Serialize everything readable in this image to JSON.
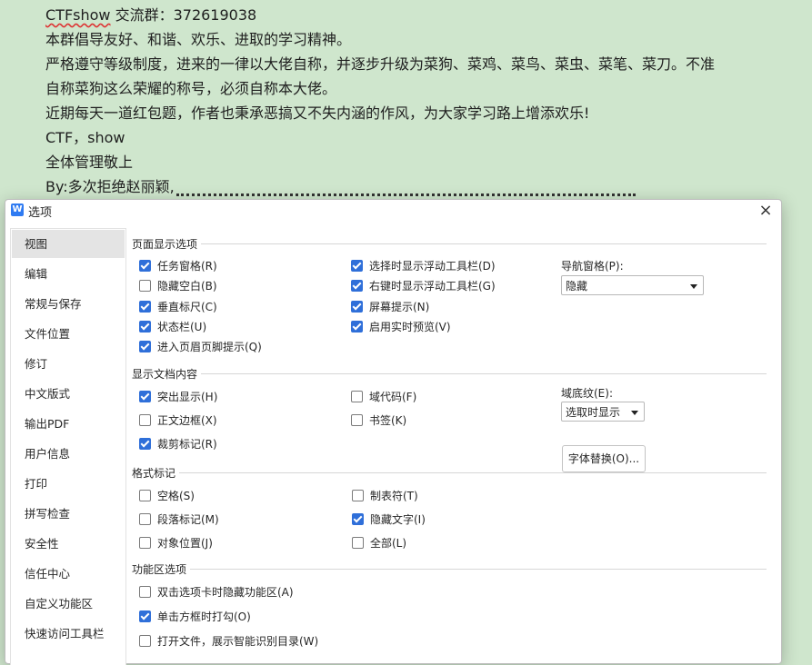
{
  "document": {
    "lines": [
      {
        "prefix": "CTFshow",
        "rest": " 交流群：372619038"
      },
      {
        "text": "本群倡导友好、和谐、欢乐、进取的学习精神。"
      },
      {
        "text": "严格遵守等级制度，进来的一律以大佬自称，并逐步升级为菜狗、菜鸡、菜鸟、菜虫、菜笔、菜刀。不准"
      },
      {
        "text": "自称菜狗这么荣耀的称号，必须自称本大佬。"
      },
      {
        "text": "近期每天一道红包题，作者也秉承恶搞又不失内涵的作风，为大家学习路上增添欢乐!"
      },
      {
        "text": "CTF，show"
      },
      {
        "text": "全体管理敬上"
      },
      {
        "text": "By:多次拒绝赵丽颖,"
      }
    ]
  },
  "dialog": {
    "title": "选项",
    "app_icon": "W",
    "close_glyph": "×",
    "sidebar": [
      {
        "label": "视图",
        "active": true
      },
      {
        "label": "编辑"
      },
      {
        "label": "常规与保存"
      },
      {
        "label": "文件位置"
      },
      {
        "label": "修订"
      },
      {
        "label": "中文版式"
      },
      {
        "label": "输出PDF"
      },
      {
        "label": "用户信息"
      },
      {
        "label": "打印"
      },
      {
        "label": "拼写检查"
      },
      {
        "label": "安全性"
      },
      {
        "label": "信任中心"
      },
      {
        "label": "自定义功能区"
      },
      {
        "label": "快速访问工具栏"
      }
    ],
    "page_display": {
      "title": "页面显示选项",
      "options": [
        {
          "label": "任务窗格(R)",
          "checked": true
        },
        {
          "label": "隐藏空白(B)",
          "checked": false
        },
        {
          "label": "垂直标尺(C)",
          "checked": true
        },
        {
          "label": "状态栏(U)",
          "checked": true
        },
        {
          "label": "进入页眉页脚提示(Q)",
          "checked": true
        },
        {
          "label": "选择时显示浮动工具栏(D)",
          "checked": true
        },
        {
          "label": "右键时显示浮动工具栏(G)",
          "checked": true
        },
        {
          "label": "屏幕提示(N)",
          "checked": true
        },
        {
          "label": "启用实时预览(V)",
          "checked": true
        }
      ],
      "nav_label": "导航窗格(P):",
      "nav_value": "隐藏"
    },
    "doc_content": {
      "title": "显示文档内容",
      "options": [
        {
          "label": "突出显示(H)",
          "checked": true
        },
        {
          "label": "正文边框(X)",
          "checked": false
        },
        {
          "label": "裁剪标记(R)",
          "checked": true
        },
        {
          "label": "域代码(F)",
          "checked": false
        },
        {
          "label": "书签(K)",
          "checked": false
        }
      ],
      "shading_label": "域底纹(E):",
      "shading_value": "选取时显示",
      "font_button": "字体替换(O)..."
    },
    "format_marks": {
      "title": "格式标记",
      "options": [
        {
          "label": "空格(S)",
          "checked": false
        },
        {
          "label": "段落标记(M)",
          "checked": false
        },
        {
          "label": "对象位置(J)",
          "checked": false
        },
        {
          "label": "制表符(T)",
          "checked": false
        },
        {
          "label": "隐藏文字(I)",
          "checked": true
        },
        {
          "label": "全部(L)",
          "checked": false
        }
      ]
    },
    "ribbon": {
      "title": "功能区选项",
      "options": [
        {
          "label": "双击选项卡时隐藏功能区(A)",
          "checked": false
        },
        {
          "label": "单击方框时打勾(O)",
          "checked": true
        },
        {
          "label": "打开文件，展示智能识别目录(W)",
          "checked": false
        }
      ]
    }
  }
}
